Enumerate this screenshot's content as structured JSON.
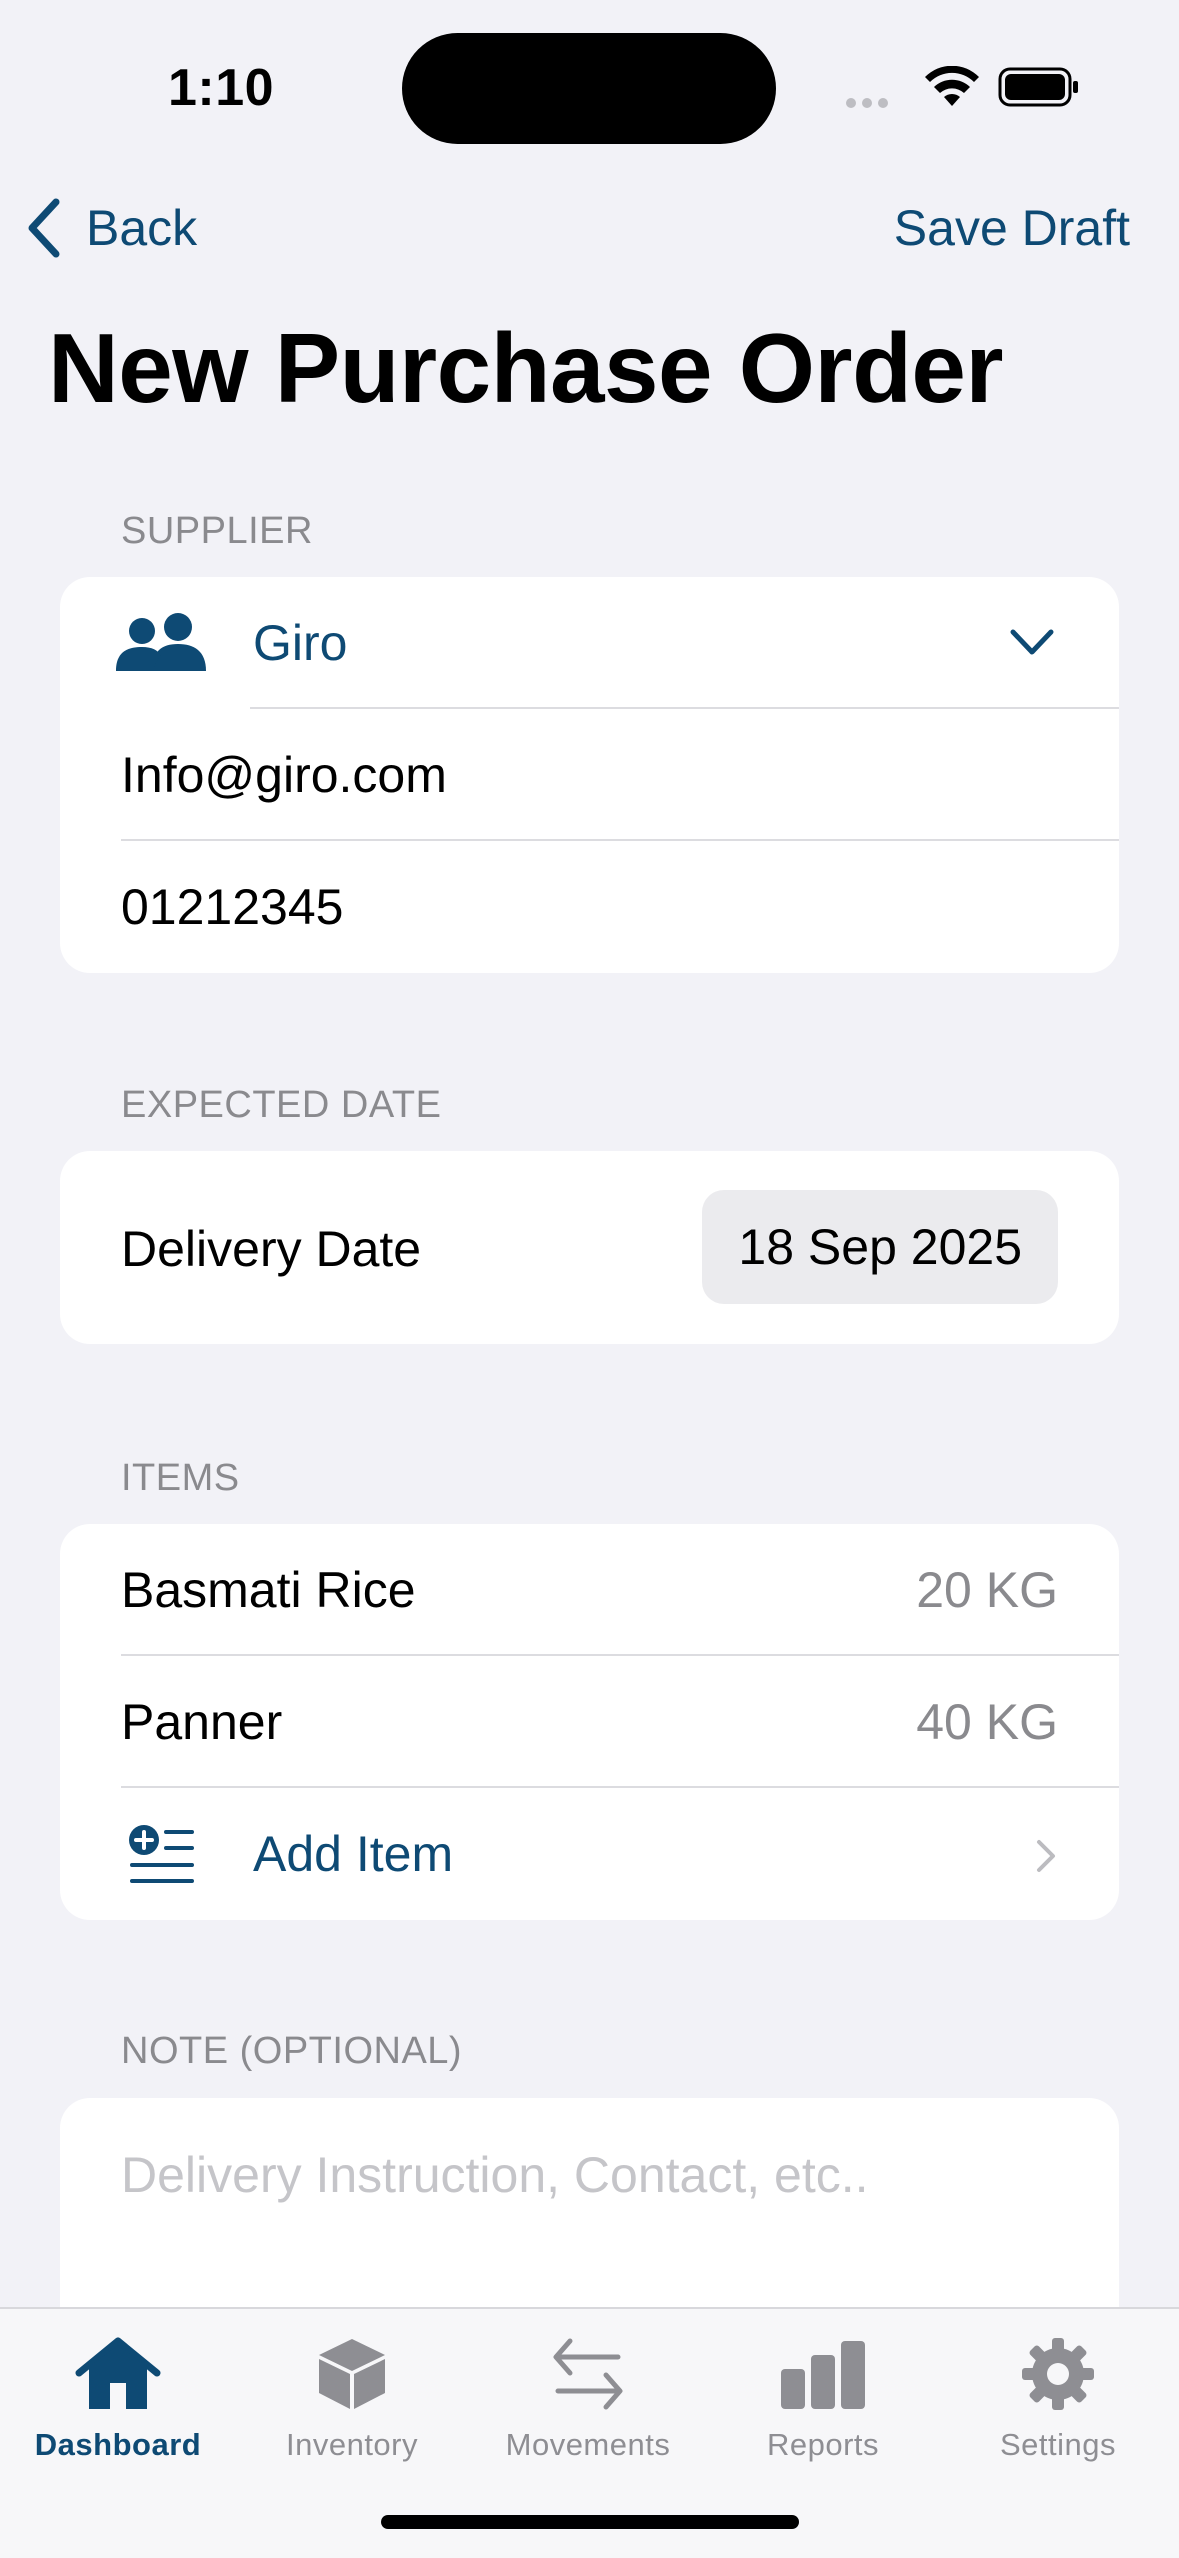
{
  "status_bar": {
    "time": "1:10"
  },
  "nav": {
    "back_label": "Back",
    "save_draft_label": "Save Draft"
  },
  "page": {
    "title": "New Purchase Order"
  },
  "supplier": {
    "section_label": "SUPPLIER",
    "name": "Giro",
    "email": "Info@giro.com",
    "phone": "01212345"
  },
  "expected_date": {
    "section_label": "EXPECTED DATE",
    "delivery_label": "Delivery Date",
    "delivery_value": "18 Sep 2025"
  },
  "items": {
    "section_label": "ITEMS",
    "list": [
      {
        "name": "Basmati Rice",
        "qty": "20 KG"
      },
      {
        "name": "Panner",
        "qty": "40 KG"
      }
    ],
    "add_label": "Add Item"
  },
  "note": {
    "section_label": "NOTE (OPTIONAL)",
    "placeholder": "Delivery Instruction, Contact, etc.."
  },
  "tabbar": {
    "tabs": [
      {
        "label": "Dashboard",
        "icon": "house-icon",
        "active": true
      },
      {
        "label": "Inventory",
        "icon": "cube-icon",
        "active": false
      },
      {
        "label": "Movements",
        "icon": "arrows-left-right-icon",
        "active": false
      },
      {
        "label": "Reports",
        "icon": "bar-chart-icon",
        "active": false
      },
      {
        "label": "Settings",
        "icon": "gear-icon",
        "active": false
      }
    ]
  },
  "colors": {
    "accent": "#0E4A74",
    "background": "#F2F2F7",
    "secondary_text": "#8A8A8E"
  }
}
